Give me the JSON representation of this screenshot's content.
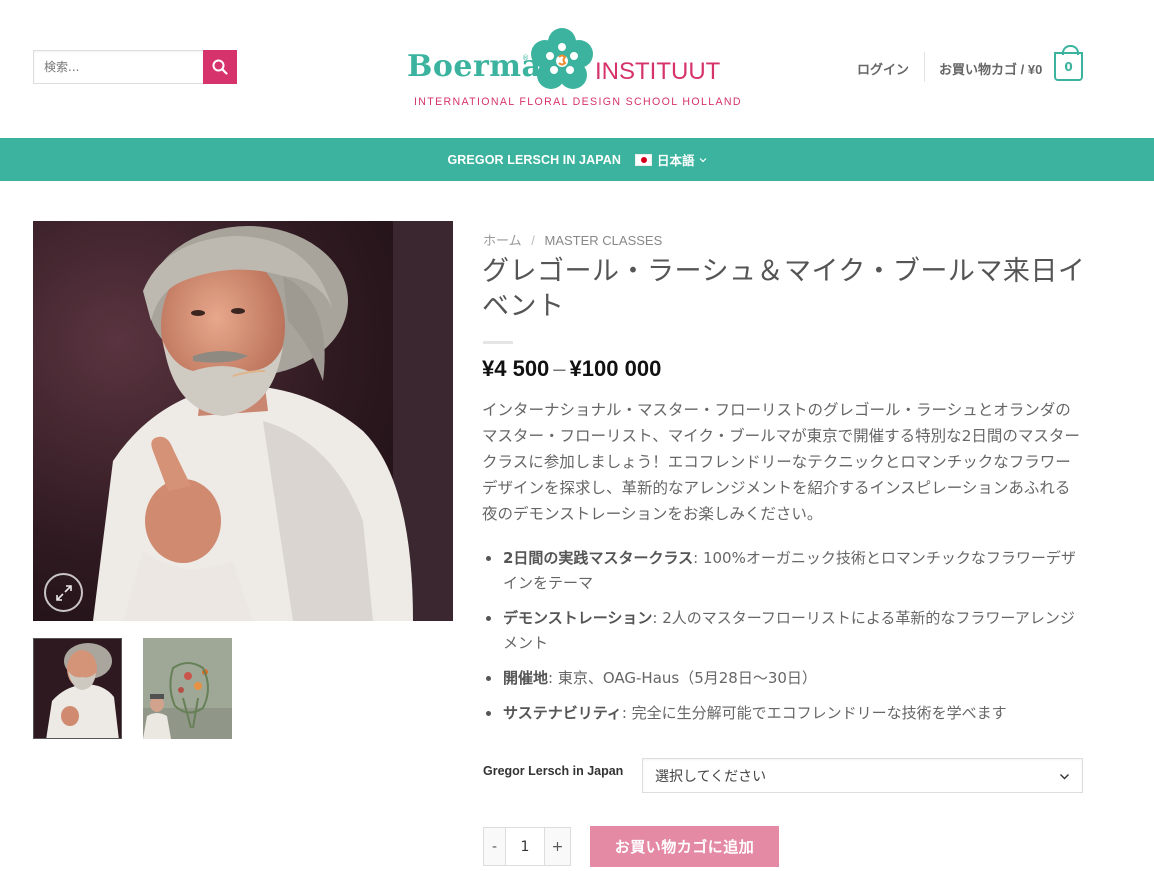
{
  "header": {
    "search_placeholder": "検索...",
    "logo": {
      "brand": "Boerma",
      "reg_mark": "®",
      "name": "INSTITUUT",
      "tagline": "INTERNATIONAL FLORAL DESIGN SCHOOL HOLLAND"
    },
    "login_label": "ログイン",
    "cart_label": "お買い物カゴ / ¥0",
    "cart_count": "0"
  },
  "nav": {
    "item": "GREGOR LERSCH IN JAPAN",
    "language": "日本語"
  },
  "breadcrumb": {
    "home": "ホーム",
    "separator": "/",
    "category": "MASTER CLASSES"
  },
  "product": {
    "title": "グレゴール・ラーシュ＆マイク・ブールマ来日イベント",
    "price_min": "¥4 500",
    "price_sep": "–",
    "price_max": "¥100 000",
    "description": "インターナショナル・マスター・フローリストのグレゴール・ラーシュとオランダのマスター・フローリスト、マイク・ブールマが東京で開催する特別な2日間のマスタークラスに参加しましょう！エコフレンドリーなテクニックとロマンチックなフラワーデザインを探求し、革新的なアレンジメントを紹介するインスピレーションあふれる夜のデモンストレーションをお楽しみください。",
    "features": [
      {
        "label": "2日間の実践マスタークラス",
        "text": ": 100%オーガニック技術とロマンチックなフラワーデザインをテーマ"
      },
      {
        "label": "デモンストレーション",
        "text": ": 2人のマスターフローリストによる革新的なフラワーアレンジメント"
      },
      {
        "label": "開催地",
        "text": ": 東京、OAG-Haus（5月28日〜30日）"
      },
      {
        "label": "サステナビリティ",
        "text": ": 完全に生分解可能でエコフレンドリーな技術を学べます"
      }
    ],
    "variation_label": "Gregor Lersch in Japan",
    "variation_selected": "選択してください",
    "quantity": "1",
    "qty_minus": "-",
    "qty_plus": "+",
    "add_to_cart": "お買い物カゴに追加"
  },
  "colors": {
    "accent_teal": "#3bb39e",
    "accent_pink": "#d6336c",
    "button_pink": "#e48aa5"
  },
  "icons": [
    "search-icon",
    "flower-logo-icon",
    "cart-icon",
    "japan-flag-icon",
    "chevron-down-icon",
    "zoom-expand-icon"
  ]
}
